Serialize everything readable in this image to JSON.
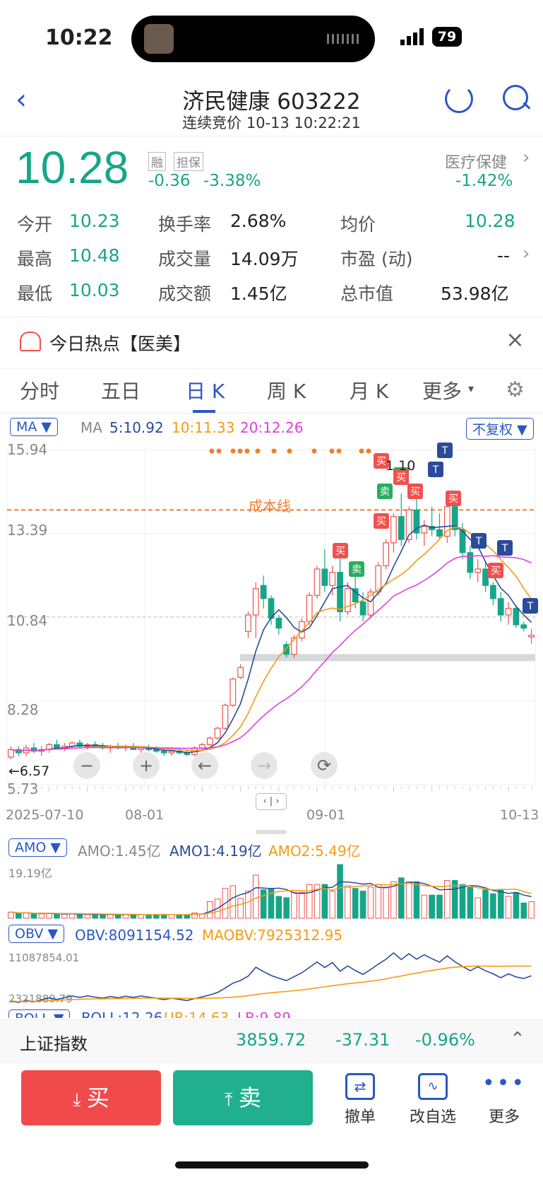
{
  "status_bar": {
    "time": "10:22",
    "battery": "79"
  },
  "header": {
    "title": "济民健康 603222",
    "subtitle": "连续竞价 10-13 10:22:21"
  },
  "quote": {
    "price": "10.28",
    "change": "-0.36",
    "change_pct": "-3.38%",
    "tag1": "融",
    "tag2": "担保",
    "sector_name": "医疗保健",
    "sector_change": "-1.42%"
  },
  "stats": [
    {
      "label": "今开",
      "value": "10.23"
    },
    {
      "label": "换手率",
      "value": "2.68%"
    },
    {
      "label": "均价",
      "value": "10.28"
    },
    {
      "label": "最高",
      "value": "10.48"
    },
    {
      "label": "成交量",
      "value": "14.09万"
    },
    {
      "label": "市盈 (动)",
      "value": "--"
    },
    {
      "label": "最低",
      "value": "10.03"
    },
    {
      "label": "成交额",
      "value": "1.45亿"
    },
    {
      "label": "总市值",
      "value": "53.98亿"
    }
  ],
  "hot": {
    "text": "今日热点【医美】"
  },
  "tabs": [
    "分时",
    "五日",
    "日 K",
    "周 K",
    "月 K",
    "更多"
  ],
  "active_tab": "日 K",
  "ma_bar": {
    "selector": "MA",
    "ma_label": "MA",
    "ma5": "5:10.92",
    "ma10": "10:11.33",
    "ma20": "20:12.26",
    "adjust": "不复权"
  },
  "kline": {
    "y_labels": [
      "15.94",
      "13.39",
      "10.84",
      "8.28",
      "5.73"
    ],
    "low_marker": "6.57",
    "high_marker": "1 10",
    "cost_line_label": "成本线",
    "x_labels": [
      "2025-07-10",
      "08-01",
      "09-01",
      "10-13"
    ],
    "signals": {
      "buy": "买",
      "sell": "卖",
      "t": "T"
    }
  },
  "amo": {
    "selector": "AMO",
    "amo": "AMO:1.45亿",
    "amo1": "AMO1:4.19亿",
    "amo2": "AMO2:5.49亿",
    "max": "19.19亿"
  },
  "obv": {
    "selector": "OBV",
    "obv": "OBV:8091154.52",
    "maobv": "MAOBV:7925312.95",
    "max": "11087854.01",
    "min": "2321889.79"
  },
  "boll": {
    "selector": "BOLL",
    "boll": "BOLL:12.26",
    "ub": "UB:14.63",
    "lb": "LB:9.89"
  },
  "index_bar": {
    "name": "上证指数",
    "value": "3859.72",
    "change": "-37.31",
    "pct": "-0.96%"
  },
  "toolbar": {
    "buy": "买",
    "sell": "卖",
    "cancel": "撤单",
    "watch": "改自选",
    "more": "更多"
  },
  "colors": {
    "up": "#f0514e",
    "down": "#17a589",
    "accent": "#2a56c6",
    "ma5": "#2a4b9b",
    "ma10": "#f39c12",
    "ma20": "#e040e0"
  },
  "chart_data": {
    "type": "candlestick",
    "ylim": [
      5.73,
      15.94
    ],
    "x_labels": [
      "2025-07-10",
      "08-01",
      "09-01",
      "10-13"
    ],
    "candles": [
      [
        6.57,
        6.9,
        6.5,
        6.8
      ],
      [
        6.8,
        6.9,
        6.6,
        6.7
      ],
      [
        6.7,
        6.95,
        6.6,
        6.85
      ],
      [
        6.85,
        7.0,
        6.7,
        6.75
      ],
      [
        6.75,
        6.9,
        6.6,
        6.8
      ],
      [
        6.8,
        7.0,
        6.7,
        6.95
      ],
      [
        6.95,
        7.1,
        6.8,
        6.85
      ],
      [
        6.85,
        7.0,
        6.75,
        6.9
      ],
      [
        6.9,
        7.05,
        6.8,
        7.0
      ],
      [
        7.0,
        7.1,
        6.85,
        6.9
      ],
      [
        6.9,
        7.0,
        6.8,
        6.95
      ],
      [
        6.95,
        7.05,
        6.85,
        6.9
      ],
      [
        6.9,
        7.0,
        6.8,
        6.85
      ],
      [
        6.85,
        6.95,
        6.7,
        6.9
      ],
      [
        6.9,
        7.0,
        6.8,
        6.85
      ],
      [
        6.85,
        6.95,
        6.75,
        6.9
      ],
      [
        6.9,
        7.0,
        6.8,
        6.8
      ],
      [
        6.8,
        6.9,
        6.7,
        6.85
      ],
      [
        6.85,
        6.95,
        6.75,
        6.8
      ],
      [
        6.8,
        6.9,
        6.7,
        6.75
      ],
      [
        6.75,
        6.85,
        6.6,
        6.7
      ],
      [
        6.7,
        6.8,
        6.6,
        6.75
      ],
      [
        6.75,
        6.85,
        6.65,
        6.7
      ],
      [
        6.7,
        6.8,
        6.6,
        6.65
      ],
      [
        6.65,
        6.9,
        6.6,
        6.85
      ],
      [
        6.85,
        7.0,
        6.75,
        6.95
      ],
      [
        6.95,
        7.2,
        6.9,
        7.15
      ],
      [
        7.15,
        7.5,
        7.1,
        7.45
      ],
      [
        7.45,
        8.2,
        7.4,
        8.15
      ],
      [
        8.15,
        9.0,
        8.1,
        8.95
      ],
      [
        9.0,
        9.4,
        8.95,
        9.3
      ],
      [
        10.4,
        11.0,
        10.2,
        10.9
      ],
      [
        10.9,
        11.9,
        10.2,
        11.7
      ],
      [
        11.8,
        12.1,
        11.1,
        11.4
      ],
      [
        11.4,
        11.5,
        10.6,
        10.8
      ],
      [
        10.8,
        10.9,
        10.3,
        10.5
      ],
      [
        10.0,
        10.1,
        9.6,
        9.7
      ],
      [
        9.7,
        10.3,
        9.6,
        10.2
      ],
      [
        10.2,
        10.8,
        10.1,
        10.7
      ],
      [
        10.7,
        11.6,
        10.6,
        11.5
      ],
      [
        11.5,
        12.4,
        11.4,
        12.3
      ],
      [
        12.3,
        12.9,
        11.6,
        11.8
      ],
      [
        11.8,
        12.4,
        11.5,
        12.2
      ],
      [
        12.2,
        12.8,
        10.7,
        11.0
      ],
      [
        11.0,
        11.9,
        10.9,
        11.7
      ],
      [
        11.7,
        12.2,
        11.1,
        11.3
      ],
      [
        11.3,
        11.6,
        10.7,
        10.9
      ],
      [
        10.9,
        11.7,
        10.8,
        11.6
      ],
      [
        11.6,
        12.5,
        11.5,
        12.4
      ],
      [
        12.4,
        13.2,
        12.3,
        13.1
      ],
      [
        13.1,
        14.0,
        12.8,
        13.9
      ],
      [
        13.9,
        14.6,
        13.0,
        13.2
      ],
      [
        13.2,
        14.2,
        13.1,
        14.1
      ],
      [
        14.1,
        14.5,
        13.2,
        13.4
      ],
      [
        13.4,
        13.8,
        13.0,
        13.6
      ],
      [
        13.6,
        14.2,
        13.3,
        13.5
      ],
      [
        13.5,
        14.0,
        13.2,
        13.3
      ],
      [
        13.3,
        14.3,
        13.1,
        14.2
      ],
      [
        14.2,
        14.7,
        13.3,
        13.5
      ],
      [
        13.5,
        13.7,
        12.6,
        12.8
      ],
      [
        12.8,
        13.0,
        12.0,
        12.2
      ],
      [
        12.2,
        12.6,
        11.9,
        12.3
      ],
      [
        12.3,
        12.5,
        11.6,
        11.8
      ],
      [
        11.8,
        11.9,
        11.2,
        11.4
      ],
      [
        11.4,
        11.6,
        10.7,
        10.9
      ],
      [
        10.9,
        11.3,
        10.6,
        11.1
      ],
      [
        11.1,
        11.2,
        10.5,
        10.6
      ],
      [
        10.6,
        10.7,
        10.4,
        10.5
      ],
      [
        10.23,
        10.48,
        10.03,
        10.28
      ]
    ],
    "series": [
      {
        "name": "MA5",
        "current": 10.92
      },
      {
        "name": "MA10",
        "current": 11.33
      },
      {
        "name": "MA20",
        "current": 12.26
      }
    ],
    "cost_line": 14.1
  }
}
